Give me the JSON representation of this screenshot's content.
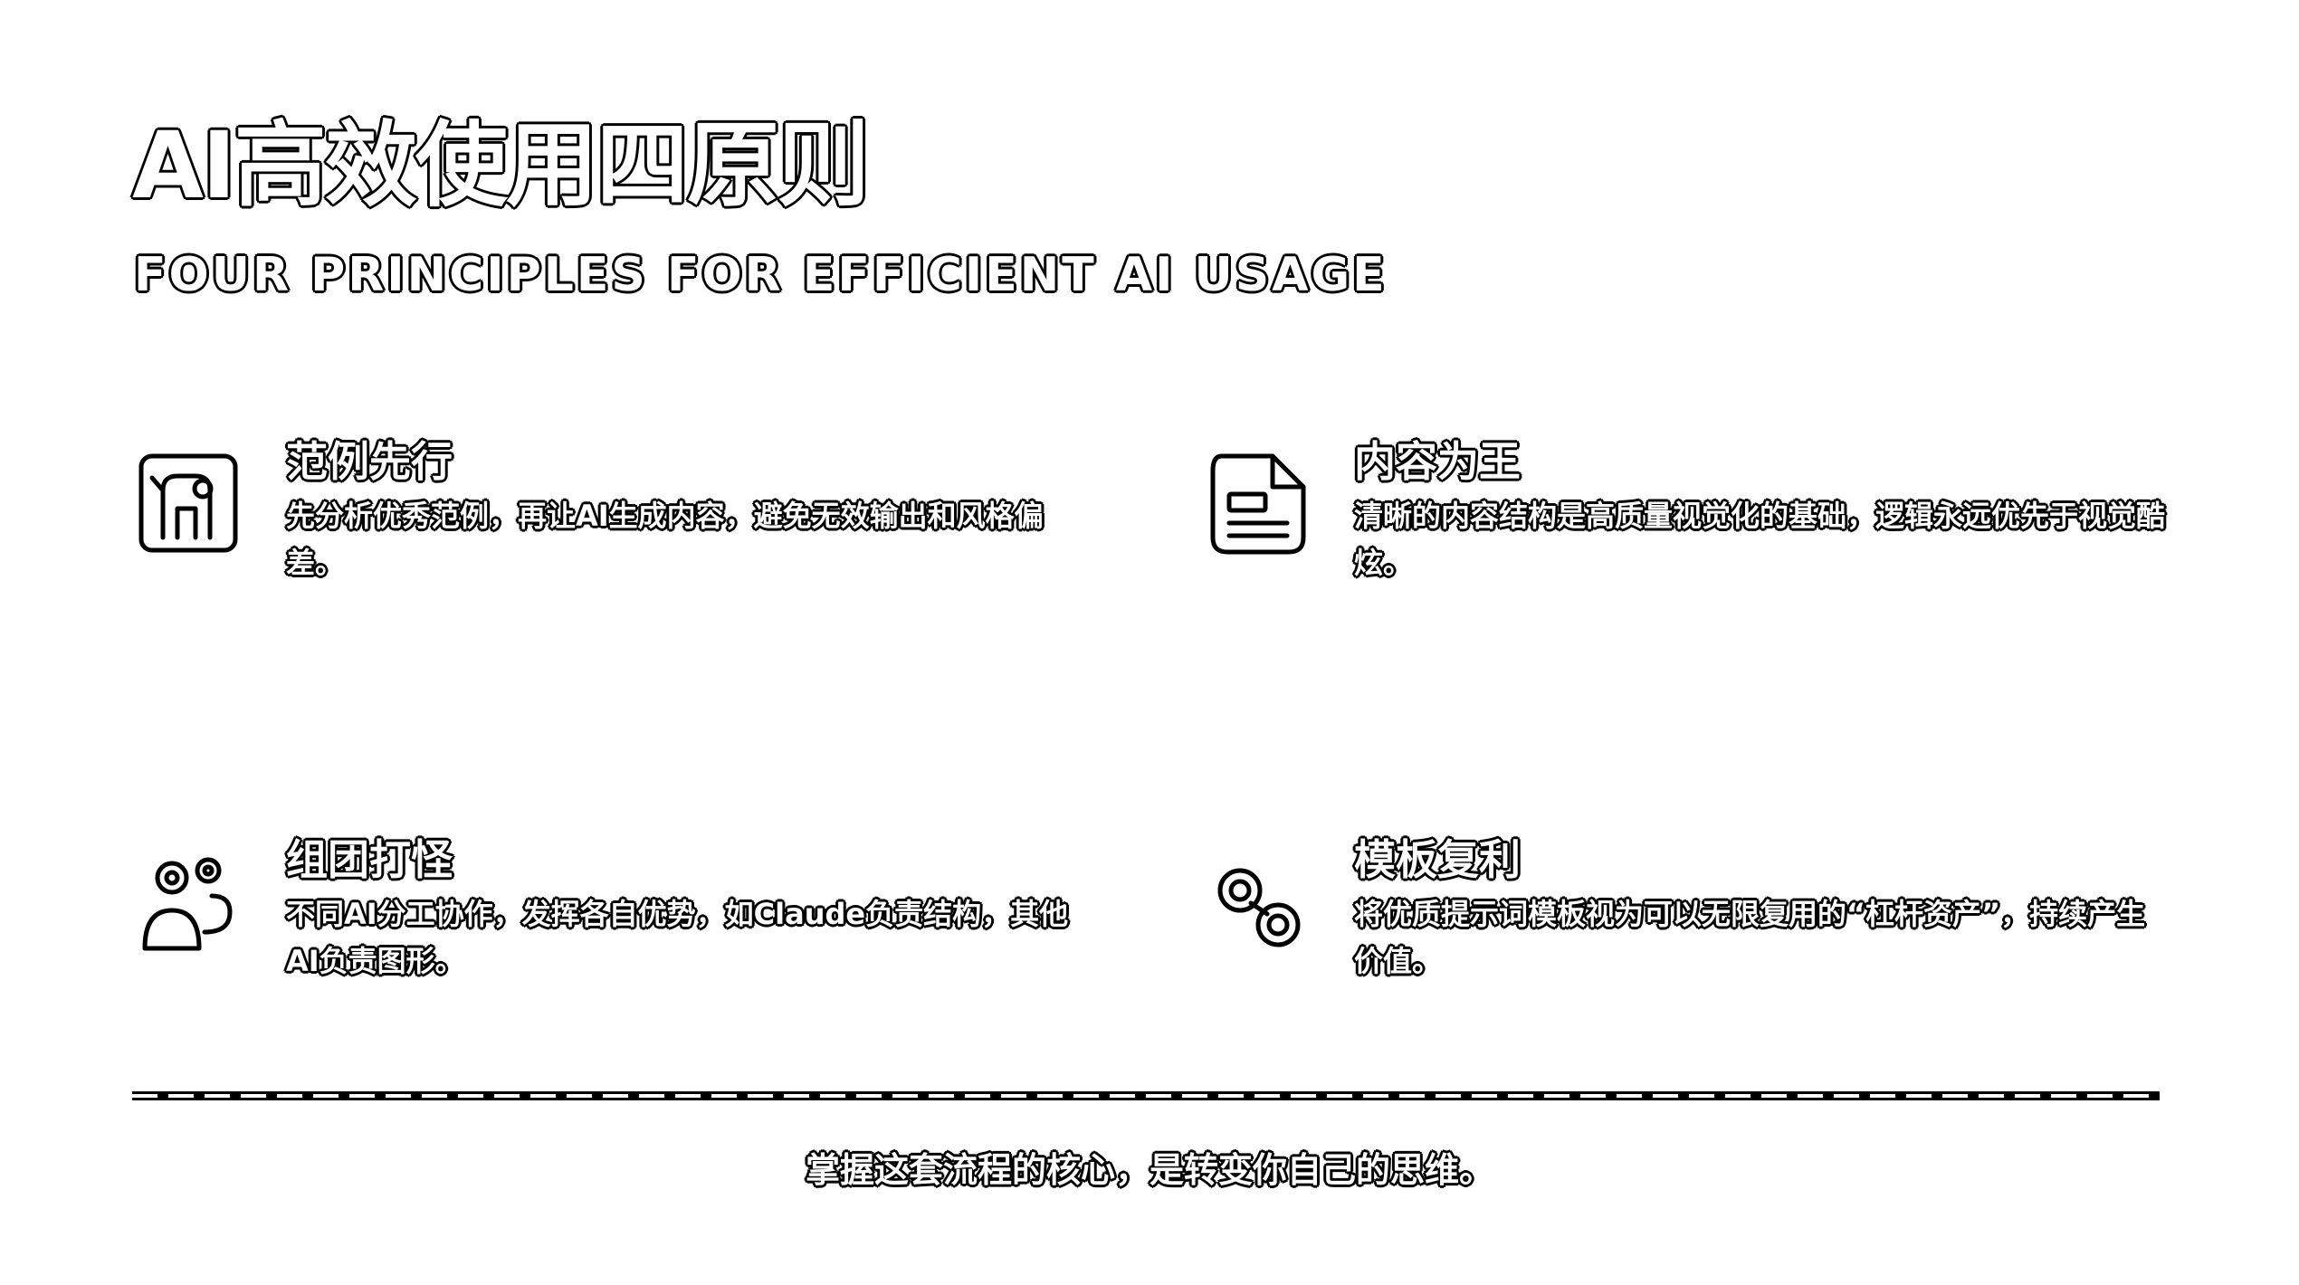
{
  "header": {
    "title": "AI高效使用四原则",
    "subtitle": "FOUR PRINCIPLES FOR EFFICIENT AI USAGE"
  },
  "principles": [
    {
      "icon": "image-frame-icon",
      "title": "范例先行",
      "description": "先分析优秀范例，再让AI生成内容，避免无效输出和风格偏差。"
    },
    {
      "icon": "document-icon",
      "title": "内容为王",
      "description": "清晰的内容结构是高质量视觉化的基础，逻辑永远优先于视觉酷炫。"
    },
    {
      "icon": "team-icon",
      "title": "组团打怪",
      "description": "不同AI分工协作，发挥各自优势，如Claude负责结构，其他AI负责图形。"
    },
    {
      "icon": "link-icon",
      "title": "模板复利",
      "description": "将优质提示词模板视为可以无限复用的“杠杆资产”，持续产生价值。"
    }
  ],
  "footer": {
    "text": "掌握这套流程的核心，是转变你自己的思维。"
  },
  "colors": {
    "background": "#ffffff",
    "text_fill": "#ffffff",
    "outline": "#000000"
  }
}
